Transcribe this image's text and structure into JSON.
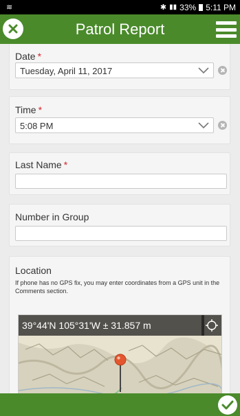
{
  "status_bar": {
    "left_icon": "notification-icon",
    "battery": "33%",
    "time": "5:11 PM"
  },
  "app_bar": {
    "title": "Patrol Report",
    "close_icon": "close-icon",
    "menu_icon": "hamburger-menu-icon"
  },
  "form": {
    "date": {
      "label": "Date",
      "required_mark": "*",
      "value": "Tuesday, April 11, 2017"
    },
    "time": {
      "label": "Time",
      "required_mark": "*",
      "value": "5:08 PM"
    },
    "last_name": {
      "label": "Last Name",
      "required_mark": "*",
      "value": ""
    },
    "number_in_group": {
      "label": "Number in Group",
      "value": ""
    },
    "location": {
      "label": "Location",
      "hint": "If phone has no GPS fix, you may enter coordinates from a GPS unit in the Comments section.",
      "coordinates": "39°44'N 105°31'W ± 31.857 m",
      "gps_icon": "crosshair-icon"
    }
  },
  "bottom_bar": {
    "save_icon": "checkmark-icon"
  },
  "colors": {
    "brand_green": "#4a8a2b",
    "required_red": "#d8232a"
  }
}
